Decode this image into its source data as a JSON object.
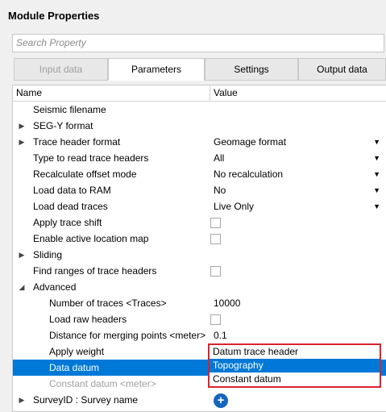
{
  "header": {
    "title": "Module Properties"
  },
  "search": {
    "placeholder": "Search Property",
    "value": ""
  },
  "tabs": [
    {
      "label": "Input data",
      "state": "disabled"
    },
    {
      "label": "Parameters",
      "state": "active"
    },
    {
      "label": "Settings",
      "state": "normal"
    },
    {
      "label": "Output data",
      "state": "normal"
    }
  ],
  "grid": {
    "col_name": "Name",
    "col_value": "Value",
    "rows": [
      {
        "name": "Seismic filename",
        "value": ""
      },
      {
        "name": "SEG-Y format",
        "value": "",
        "expander": "collapsed"
      },
      {
        "name": "Trace header format",
        "value": "Geomage format",
        "expander": "collapsed",
        "dropdown": true
      },
      {
        "name": "Type to read trace headers",
        "value": "All",
        "dropdown": true
      },
      {
        "name": "Recalculate offset mode",
        "value": "No recalculation",
        "dropdown": true
      },
      {
        "name": "Load data to RAM",
        "value": "No",
        "dropdown": true
      },
      {
        "name": "Load dead traces",
        "value": "Live Only",
        "dropdown": true
      },
      {
        "name": "Apply trace shift",
        "checkbox": true
      },
      {
        "name": "Enable active location map",
        "checkbox": true
      },
      {
        "name": "Sliding",
        "expander": "collapsed"
      },
      {
        "name": "Find ranges of trace headers",
        "checkbox": true
      },
      {
        "name": "Advanced",
        "expander": "expanded"
      },
      {
        "name": "Number of traces <Traces>",
        "value": "10000"
      },
      {
        "name": "Load raw headers",
        "checkbox": true
      },
      {
        "name": "Distance for merging points <meter>",
        "value": "0.1"
      },
      {
        "name": "Apply weight",
        "value": ""
      },
      {
        "name": "Data datum",
        "value": "",
        "selected": true
      },
      {
        "name": "Constant datum <meter>",
        "value": "",
        "disabled": true
      },
      {
        "name": "SurveyID : Survey name",
        "expander": "collapsed",
        "add_button": true
      }
    ]
  },
  "datum_dropdown": {
    "options": [
      "Datum trace header",
      "Topography",
      "Constant datum"
    ],
    "selected": "Topography"
  },
  "colors": {
    "selection": "#0078d7",
    "highlight_border": "#d9232d",
    "add_button": "#1565c0"
  }
}
